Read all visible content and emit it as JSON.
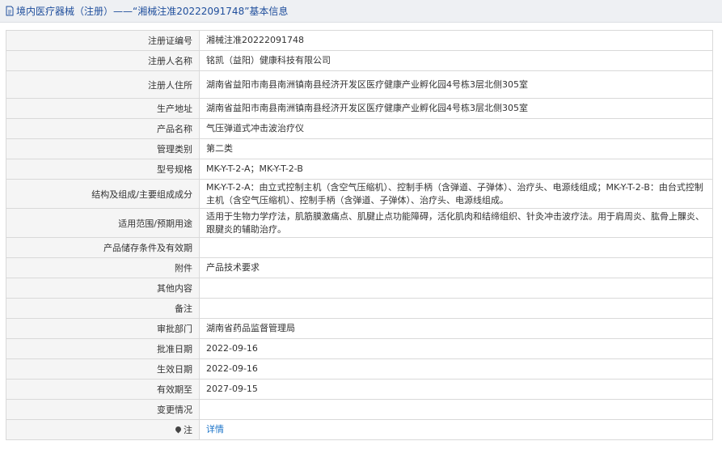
{
  "header": {
    "icon": "document-icon",
    "title": "境内医疗器械（注册）——“湘械注准20222091748”基本信息"
  },
  "rows": [
    {
      "label": "注册证编号",
      "value": "湘械注准20222091748"
    },
    {
      "label": "注册人名称",
      "value": "铭凯（益阳）健康科技有限公司"
    },
    {
      "label": "注册人住所",
      "value": "湖南省益阳市南县南洲镇南县经济开发区医疗健康产业孵化园4号栋3层北侧305室"
    },
    {
      "label": "生产地址",
      "value": "湖南省益阳市南县南洲镇南县经济开发区医疗健康产业孵化园4号栋3层北侧305室"
    },
    {
      "label": "产品名称",
      "value": "气压弹道式冲击波治疗仪"
    },
    {
      "label": "管理类别",
      "value": "第二类"
    },
    {
      "label": "型号规格",
      "value": "MK-Y-T-2-A；MK-Y-T-2-B"
    },
    {
      "label": "结构及组成/主要组成成分",
      "value": "MK-Y-T-2-A：由立式控制主机（含空气压缩机）、控制手柄（含弹道、子弹体）、治疗头、电源线组成；MK-Y-T-2-B：由台式控制主机（含空气压缩机）、控制手柄（含弹道、子弹体）、治疗头、电源线组成。"
    },
    {
      "label": "适用范围/预期用途",
      "value": "适用于生物力学疗法，肌筋膜激痛点、肌腱止点功能障碍，活化肌肉和结缔组织、针灸冲击波疗法。用于肩周炎、肱骨上髁炎、跟腱炎的辅助治疗。"
    },
    {
      "label": "产品储存条件及有效期",
      "value": ""
    },
    {
      "label": "附件",
      "value": "产品技术要求"
    },
    {
      "label": "其他内容",
      "value": ""
    },
    {
      "label": "备注",
      "value": ""
    },
    {
      "label": "审批部门",
      "value": "湖南省药品监督管理局"
    },
    {
      "label": "批准日期",
      "value": "2022-09-16"
    },
    {
      "label": "生效日期",
      "value": "2022-09-16"
    },
    {
      "label": "有效期至",
      "value": "2027-09-15"
    },
    {
      "label": "变更情况",
      "value": ""
    }
  ],
  "note": {
    "icon": "pin-icon",
    "label": "注",
    "link": "详情"
  }
}
